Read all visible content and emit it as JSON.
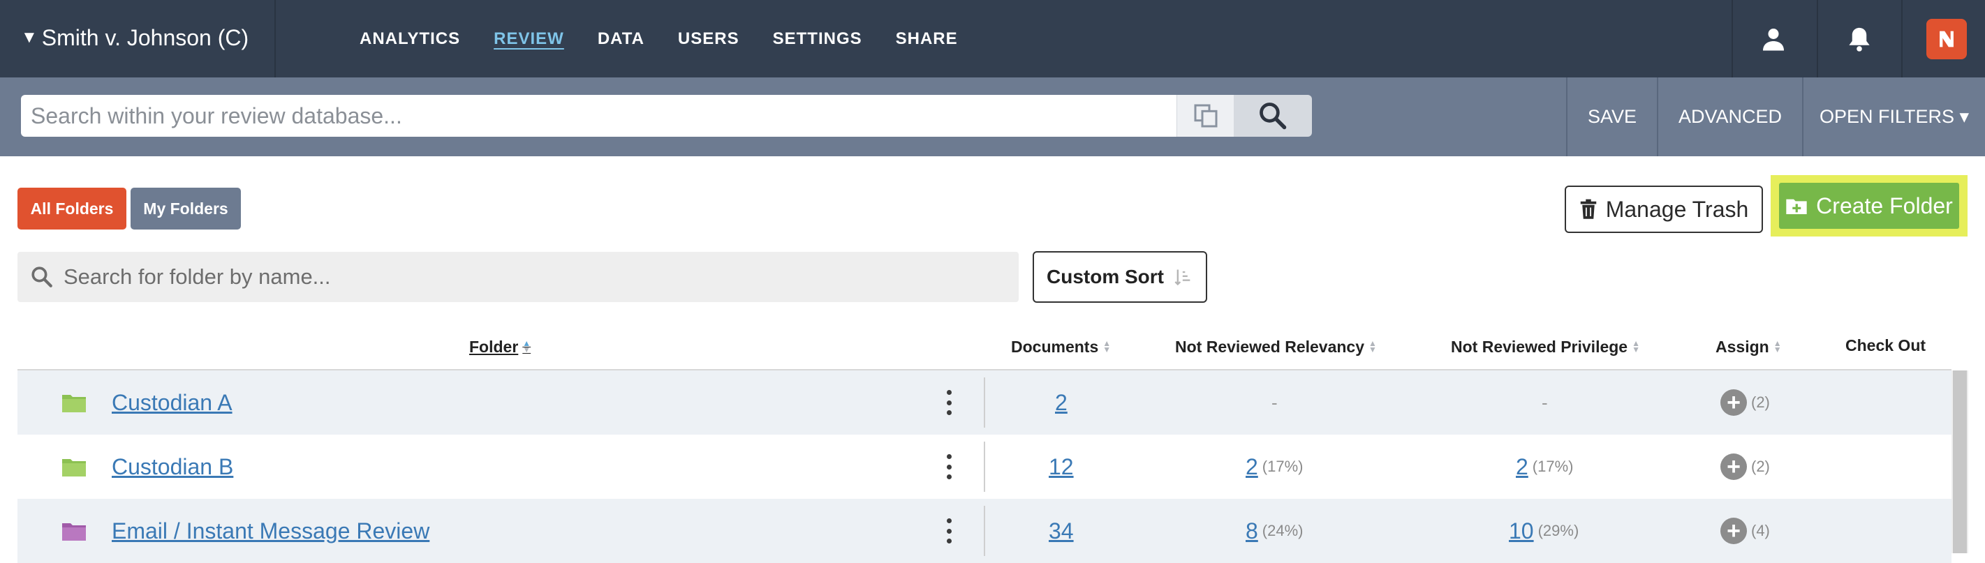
{
  "topnav": {
    "case_title": "Smith v. Johnson (C)",
    "links": [
      "ANALYTICS",
      "REVIEW",
      "DATA",
      "USERS",
      "SETTINGS",
      "SHARE"
    ],
    "active_link": "REVIEW",
    "icons": [
      "user-icon",
      "bell-icon",
      "app-logo-icon"
    ],
    "accent_color": "#e0522f"
  },
  "search": {
    "placeholder": "Search within your review database...",
    "save_label": "SAVE",
    "advanced_label": "ADVANCED",
    "open_filters_label": "OPEN FILTERS ▾"
  },
  "folders": {
    "all_folders_label": "All Folders",
    "my_folders_label": "My Folders",
    "manage_trash_label": "Manage Trash",
    "create_folder_label": "Create Folder",
    "search_placeholder": "Search for folder by name...",
    "custom_sort_label": "Custom Sort"
  },
  "table": {
    "columns": {
      "folder": "Folder",
      "documents": "Documents",
      "not_reviewed_relevancy": "Not Reviewed Relevancy",
      "not_reviewed_privilege": "Not Reviewed Privilege",
      "assign": "Assign",
      "check_out": "Check Out"
    },
    "rows": [
      {
        "name": "Custodian A",
        "folder_color": "#8cc152",
        "documents": "2",
        "relevancy": "-",
        "relevancy_pct": "",
        "privilege": "-",
        "privilege_pct": "",
        "assign_count": "(2)"
      },
      {
        "name": "Custodian B",
        "folder_color": "#8cc152",
        "documents": "12",
        "relevancy": "2",
        "relevancy_pct": "(17%)",
        "privilege": "2",
        "privilege_pct": "(17%)",
        "assign_count": "(2)"
      },
      {
        "name": "Email / Instant Message Review",
        "folder_color": "#a05aa8",
        "documents": "34",
        "relevancy": "8",
        "relevancy_pct": "(24%)",
        "privilege": "10",
        "privilege_pct": "(29%)",
        "assign_count": "(4)"
      }
    ]
  }
}
